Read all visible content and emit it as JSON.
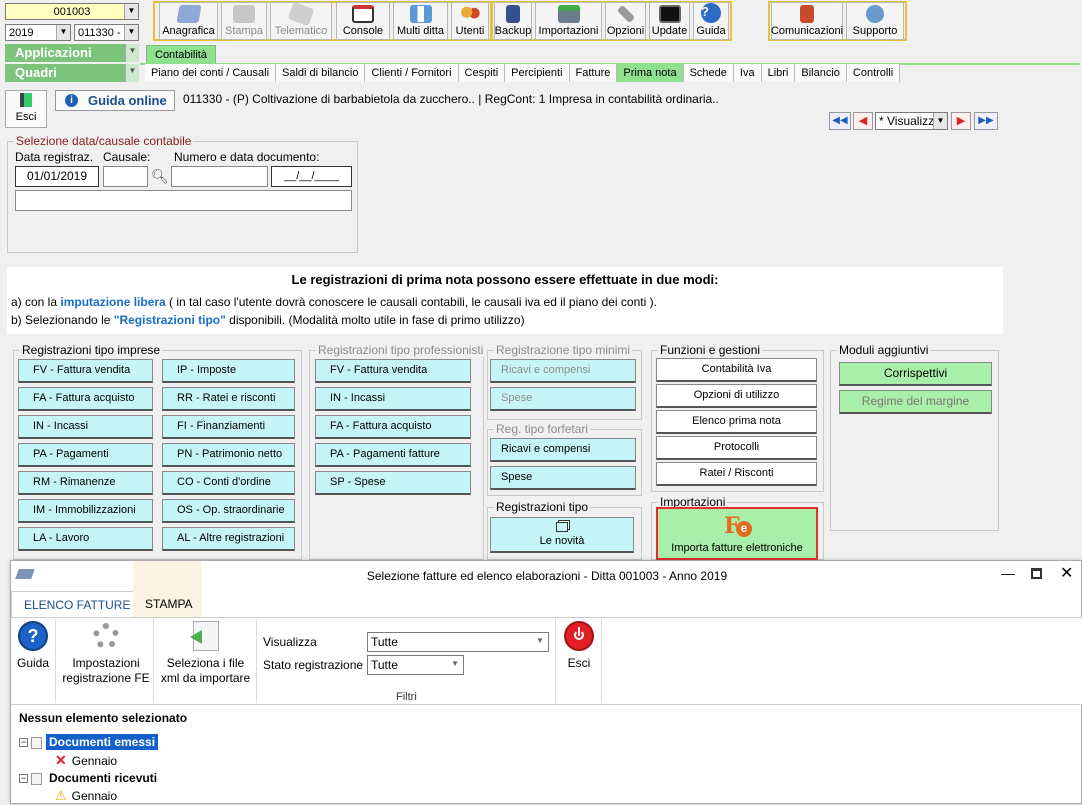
{
  "header": {
    "ditta": "001003",
    "year": "2019",
    "code": "011330 -",
    "applicazioni": "Applicazioni",
    "quadri": "Quadri",
    "contabilita_tab": "Contabilità"
  },
  "toolbar": [
    {
      "label": "Anagrafica",
      "disabled": false
    },
    {
      "label": "Stampa",
      "disabled": true
    },
    {
      "label": "Telematico",
      "disabled": true
    },
    {
      "label": "Console",
      "disabled": false
    },
    {
      "label": "Multi ditta",
      "disabled": false
    },
    {
      "label": "Utenti",
      "disabled": false
    },
    {
      "label": "Backup",
      "disabled": false
    },
    {
      "label": "Importazioni",
      "disabled": false
    },
    {
      "label": "Opzioni",
      "disabled": false
    },
    {
      "label": "Update",
      "disabled": false
    },
    {
      "label": "Guida",
      "disabled": false
    },
    {
      "label": "Comunicazioni",
      "disabled": false
    },
    {
      "label": "Supporto",
      "disabled": false
    }
  ],
  "nav_tabs": [
    "Piano dei conti / Causali",
    "Saldi di bilancio",
    "Clienti / Fornitori",
    "Cespiti",
    "Percipienti",
    "Fatture",
    "Prima nota",
    "Schede",
    "Iva",
    "Libri",
    "Bilancio",
    "Controlli"
  ],
  "active_nav": "Prima nota",
  "esci": "Esci",
  "guida_online": "Guida online",
  "company_info": "011330 - (P) Coltivazione di barbabietola da zucchero.. | RegCont: 1 Impresa  in contabilità ordinaria..",
  "view_select": "* Visualizz",
  "selezione": {
    "legend": "Selezione data/causale contabile",
    "data_label": "Data registraz.",
    "causale_label": "Causale:",
    "numero_label": "Numero e data documento:",
    "data_value": "01/01/2019",
    "date_placeholder": "__/__/____"
  },
  "info": {
    "title": "Le registrazioni di prima nota possono essere effettuate in due modi:",
    "line_a_pre": "a) con la ",
    "line_a_link": "imputazione libera",
    "line_a_post": " ( in tal caso l'utente dovrà conoscere le causali contabili, le causali iva ed il piano dei conti ).",
    "line_b_pre": "b) Selezionando le ",
    "line_b_link": "\"Registrazioni tipo\"",
    "line_b_post": " disponibili. (Modalità molto utile in fase di primo utilizzo)"
  },
  "groups": {
    "imprese": {
      "legend": "Registrazioni tipo imprese",
      "col1": [
        "FV - Fattura vendita",
        "FA - Fattura acquisto",
        "IN - Incassi",
        "PA - Pagamenti",
        "RM - Rimanenze",
        "IM - Immobilizzazioni",
        "LA - Lavoro"
      ],
      "col2": [
        "IP - Imposte",
        "RR - Ratei e risconti",
        "FI - Finanziamenti",
        "PN - Patrimonio netto",
        "CO - Conti d'ordine",
        "OS - Op. straordinarie",
        "AL - Altre registrazioni"
      ]
    },
    "professionisti": {
      "legend": "Registrazioni tipo professionisti",
      "items": [
        "FV - Fattura vendita",
        "IN - Incassi",
        "FA - Fattura acquisto",
        "PA - Pagamenti fatture",
        "SP - Spese"
      ]
    },
    "minimi": {
      "legend": "Registrazione tipo minimi",
      "items": [
        "Ricavi e compensi",
        "Spese"
      ]
    },
    "forfetari": {
      "legend": "Reg. tipo forfetari",
      "items": [
        "Ricavi e compensi",
        "Spese"
      ]
    },
    "registrazioni_tipo": {
      "legend": "Registrazioni tipo",
      "novita": "Le novità"
    },
    "funzioni": {
      "legend": "Funzioni e gestioni",
      "items": [
        "Contabilità Iva",
        "Opzioni di utilizzo",
        "Elenco prima nota",
        "Protocolli",
        "Ratei / Risconti"
      ]
    },
    "moduli": {
      "legend": "Moduli aggiuntivi",
      "items": [
        "Corrispettivi",
        "Regime del margine"
      ]
    },
    "importazioni": {
      "legend": "Importazioni",
      "button": "Importa fatture elettroniche"
    }
  },
  "window": {
    "title": "Selezione fatture ed elenco elaborazioni - Ditta 001003 - Anno 2019",
    "tabs": [
      "ELENCO FATTURE",
      "STAMPA"
    ],
    "buttons": {
      "guida": "Guida",
      "impostazioni_1": "Impostazioni",
      "impostazioni_2": "registrazione FE",
      "seleziona_1": "Seleziona i file",
      "seleziona_2": "xml da importare",
      "esci": "Esci"
    },
    "filters": {
      "visualizza_label": "Visualizza",
      "visualizza_value": "Tutte",
      "stato_label": "Stato registrazione",
      "stato_value": "Tutte",
      "group_label": "Filtri"
    },
    "nessun": "Nessun elemento selezionato",
    "tree": {
      "emessi": "Documenti emessi",
      "emessi_child": "Gennaio",
      "ricevuti": "Documenti ricevuti",
      "ricevuti_child": "Gennaio"
    }
  },
  "colors": {
    "accent_green": "#7cc37c",
    "cyan_btn": "#c6f5f7",
    "red_highlight": "#e03030",
    "link_blue": "#1a6ec8"
  }
}
